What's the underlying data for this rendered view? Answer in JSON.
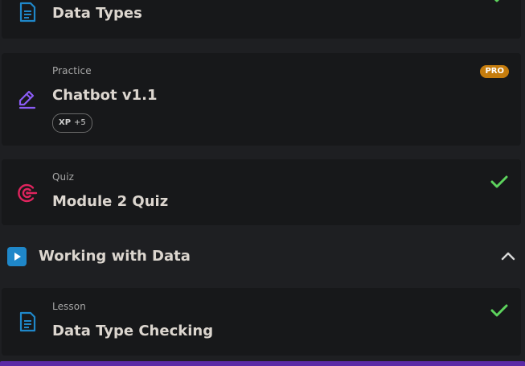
{
  "items": [
    {
      "title": "Data Types",
      "icon": "document-icon",
      "completed": true
    },
    {
      "kind": "Practice",
      "title": "Chatbot v1.1",
      "icon": "pencil-icon",
      "badge": "PRO",
      "xp_label": "XP",
      "xp_value": "+5",
      "completed": false
    },
    {
      "kind": "Quiz",
      "title": "Module 2 Quiz",
      "icon": "target-icon",
      "completed": true
    }
  ],
  "section": {
    "title": "Working with Data",
    "icon": "play-icon",
    "expanded": true
  },
  "section_items": [
    {
      "kind": "Lesson",
      "title": "Data Type Checking",
      "icon": "document-icon",
      "completed": true
    }
  ],
  "colors": {
    "background": "#1e1f22",
    "card": "#17181a",
    "lesson_icon": "#1f87c9",
    "practice_icon": "#8b5cf6",
    "quiz_icon": "#e0245e",
    "check": "#5dd35d",
    "pro_badge": "#c57c0d",
    "accent_bar": "#5b2aa6"
  }
}
